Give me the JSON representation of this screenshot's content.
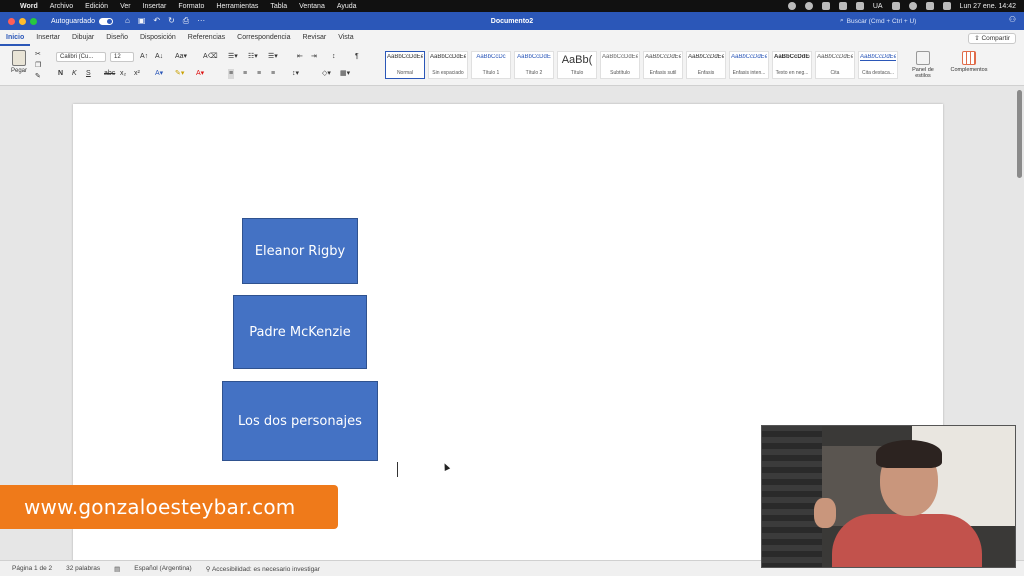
{
  "menubar": {
    "app_name": "Word",
    "items": [
      "Archivo",
      "Edición",
      "Ver",
      "Insertar",
      "Formato",
      "Herramientas",
      "Tabla",
      "Ventana",
      "Ayuda"
    ],
    "input_lang": "UA",
    "clock": "Lun 27 ene.  14:42"
  },
  "titlebar": {
    "autosave_label": "Autoguardado",
    "doc_title": "Documento2",
    "search_placeholder": "Buscar (Cmd + Ctrl + U)"
  },
  "tabs": [
    "Inicio",
    "Insertar",
    "Dibujar",
    "Diseño",
    "Disposición",
    "Referencias",
    "Correspondencia",
    "Revisar",
    "Vista"
  ],
  "active_tab": "Inicio",
  "share_label": "Compartir",
  "ribbon": {
    "paste_label": "Pegar",
    "font_name": "Calibri (Cu...",
    "font_size": "12",
    "bold": "N",
    "italic": "K",
    "underline": "S",
    "strike": "abc",
    "subscript": "x₂",
    "superscript": "x²",
    "styles": [
      {
        "preview": "AaBbCcDdEe",
        "name": "Normal"
      },
      {
        "preview": "AaBbCcDdEe",
        "name": "Sin espaciado"
      },
      {
        "preview": "AaBbCcDc",
        "name": "Título 1"
      },
      {
        "preview": "AaBbCcDdE",
        "name": "Título 2"
      },
      {
        "preview": "AaBb(",
        "name": "Título"
      },
      {
        "preview": "AaBbCcDdEe",
        "name": "Subtítulo"
      },
      {
        "preview": "AaBbCcDdEe",
        "name": "Énfasis sutil"
      },
      {
        "preview": "AaBbCcDdEe",
        "name": "Énfasis"
      },
      {
        "preview": "AaBbCcDdEe",
        "name": "Énfasis inten..."
      },
      {
        "preview": "AaBbCcDdEe",
        "name": "Texto en neg..."
      },
      {
        "preview": "AaBbCcDdEe",
        "name": "Cita"
      },
      {
        "preview": "AaBbCcDdEe",
        "name": "Cita destaca..."
      }
    ],
    "panel_label": "Panel de estilos",
    "complements_label": "Complementos"
  },
  "document": {
    "boxes": [
      {
        "label": "Eleanor Rigby"
      },
      {
        "label": "Padre McKenzie"
      },
      {
        "label": "Los dos personajes"
      }
    ]
  },
  "statusbar": {
    "page": "Página 1 de 2",
    "words": "32 palabras",
    "language": "Español (Argentina)",
    "accessibility": "Accesibilidad: es necesario investigar"
  },
  "overlay": {
    "banner_text": "www.gonzaloesteybar.com"
  },
  "colors": {
    "accent": "#2b57b8",
    "shape_fill": "#4472c4",
    "banner": "#ef7a1a"
  }
}
